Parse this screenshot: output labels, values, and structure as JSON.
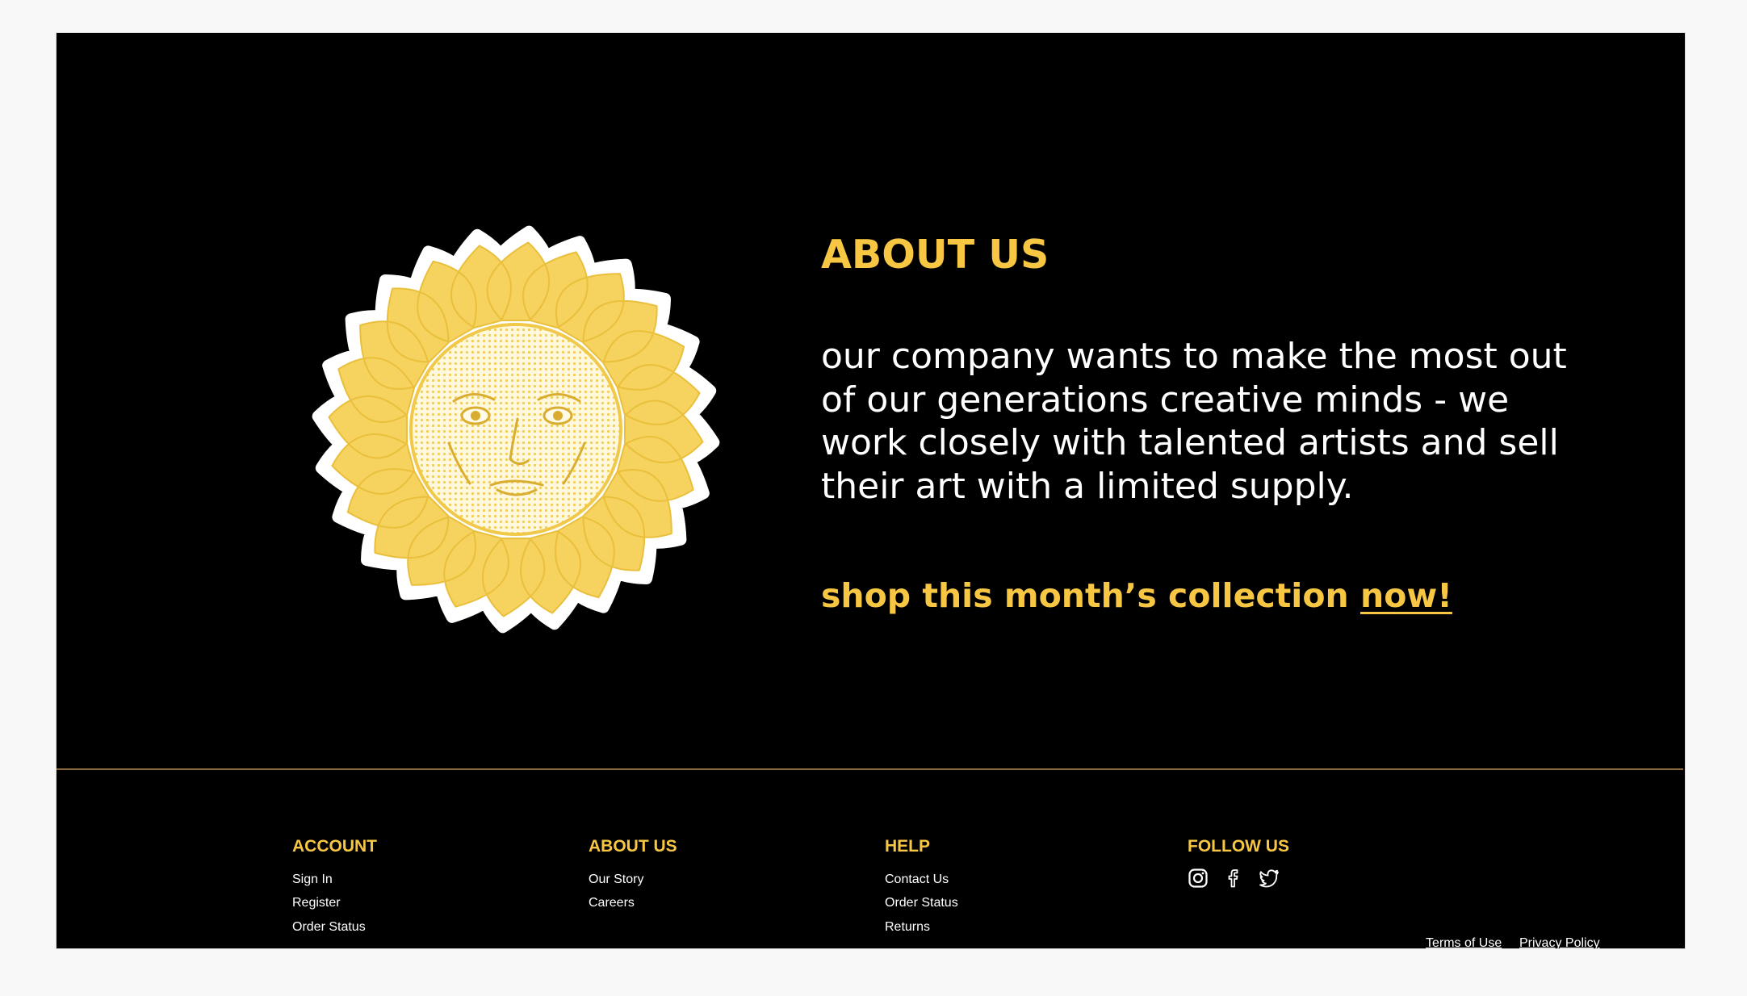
{
  "about": {
    "heading": "ABOUT US",
    "body": "our company wants to make the most out of our generations creative minds - we work closely with talented artists and sell their art with a limited supply.",
    "cta_text": "shop this month’s collection ",
    "cta_link": "now!"
  },
  "footer": {
    "account": {
      "heading": "ACCOUNT",
      "links": [
        "Sign In",
        "Register",
        "Order Status"
      ]
    },
    "about_us": {
      "heading": "ABOUT US",
      "links": [
        "Our Story",
        "Careers"
      ]
    },
    "help": {
      "heading": "HELP",
      "links": [
        "Contact Us",
        "Order Status",
        "Returns"
      ]
    },
    "follow_us": {
      "heading": "FOLLOW US",
      "icons": [
        "instagram-icon",
        "facebook-icon",
        "twitter-icon"
      ]
    },
    "legal": {
      "terms": "Terms of Use",
      "privacy": "Privacy Policy"
    }
  },
  "colors": {
    "background": "#000000",
    "accent": "#f7c744",
    "text": "#ffffff",
    "divider": "#8a6a3f"
  }
}
